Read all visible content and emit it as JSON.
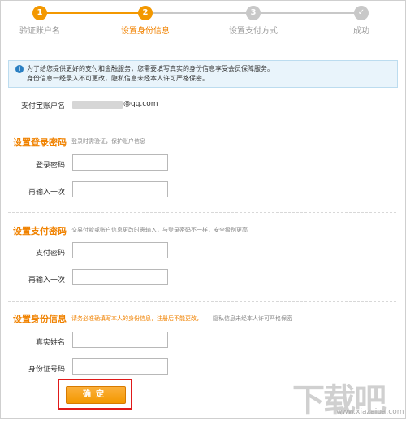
{
  "steps": [
    {
      "number": "1",
      "label": "验证账户名",
      "state": "done"
    },
    {
      "number": "2",
      "label": "设置身份信息",
      "state": "active"
    },
    {
      "number": "3",
      "label": "设置支付方式",
      "state": "todo"
    },
    {
      "number": "✓",
      "label": "成功",
      "state": "todo"
    }
  ],
  "info": {
    "line1": "为了给您提供更好的支付和金融服务，您需要填写真实的身份信息享受会员保障服务。",
    "line2": "身份信息一经录入不可更改，隐私信息未经本人许可严格保密。"
  },
  "account": {
    "label": "支付宝账户名",
    "value": "@qq.com"
  },
  "login_password": {
    "title": "设置登录密码",
    "note": "登录时需验证，保护账户信息",
    "field1_label": "登录密码",
    "field2_label": "再输入一次"
  },
  "pay_password": {
    "title": "设置支付密码",
    "note": "交易付款或账户信息更改时需输入，与登录密码不一样，安全级别更高",
    "field1_label": "支付密码",
    "field2_label": "再输入一次"
  },
  "identity": {
    "title": "设置身份信息",
    "note_orange": "请务必准确填写本人的身份信息，注册后不能更改，",
    "note_grey": "隐私信息未经本人许可严格保密",
    "field1_label": "真实姓名",
    "field2_label": "身份证号码"
  },
  "confirm_label": "确定",
  "watermark": {
    "main": "下载吧",
    "sub": "www.xiazaiba.com"
  },
  "colors": {
    "accent": "#f08200",
    "step_done": "#f39800",
    "step_todo": "#c8c8c8",
    "highlight_border": "#e01a1a"
  }
}
